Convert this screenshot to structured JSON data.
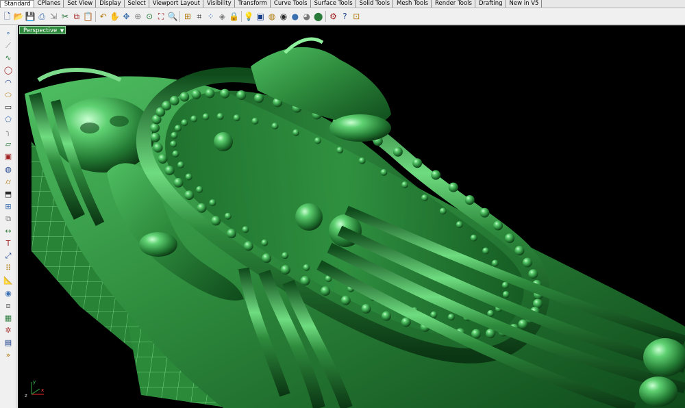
{
  "tabs": [
    {
      "label": "Standard",
      "active": true
    },
    {
      "label": "CPlanes"
    },
    {
      "label": "Set View"
    },
    {
      "label": "Display"
    },
    {
      "label": "Select"
    },
    {
      "label": "Viewport Layout"
    },
    {
      "label": "Visibility"
    },
    {
      "label": "Transform"
    },
    {
      "label": "Curve Tools"
    },
    {
      "label": "Surface Tools"
    },
    {
      "label": "Solid Tools"
    },
    {
      "label": "Mesh Tools"
    },
    {
      "label": "Render Tools"
    },
    {
      "label": "Drafting"
    },
    {
      "label": "New in V5"
    }
  ],
  "toolbar_icons": [
    "new-file-icon",
    "open-file-icon",
    "save-icon",
    "print-icon",
    "import-icon",
    "cut-icon",
    "copy-icon",
    "paste-icon",
    "undo-icon",
    "pan-hand-icon",
    "move-view-icon",
    "zoom-window-icon",
    "zoom-dynamic-icon",
    "zoom-extents-icon",
    "zoom-selected-icon",
    "four-viewports-icon",
    "cplane-icon",
    "points-on-icon",
    "layers-icon",
    "lock-icon",
    "light-bulb-icon",
    "object-properties-icon",
    "color-wheel-icon",
    "render-preview-icon",
    "shaded-sphere-icon",
    "rendered-sphere-icon",
    "blue-sphere-icon",
    "gear-options-icon",
    "help-icon",
    "grid-snap-icon"
  ],
  "left_icons": [
    "point-icon",
    "polyline-icon",
    "curve-icon",
    "circle-icon",
    "arc-icon",
    "ellipse-icon",
    "rectangle-icon",
    "polygon-icon",
    "fillet-icon",
    "surface-icon",
    "box-icon",
    "sphere-icon",
    "cylinder-icon",
    "extrude-icon",
    "mesh-icon",
    "boolean-icon",
    "dimension-icon",
    "text-icon",
    "transform-icon",
    "array-icon",
    "analyze-icon",
    "render-icon",
    "group-icon",
    "block-icon",
    "explode-icon",
    "layout-icon",
    "more-arrow-icon"
  ],
  "viewport": {
    "title": "Perspective",
    "dropdown_glyph": "▼",
    "axis_x": "x",
    "axis_y": "y",
    "axis_z": "z",
    "colors": {
      "background": "#000000",
      "model": "#2e8b3d",
      "highlight": "#9fe6a8",
      "wire": "#7ddc8c"
    }
  }
}
